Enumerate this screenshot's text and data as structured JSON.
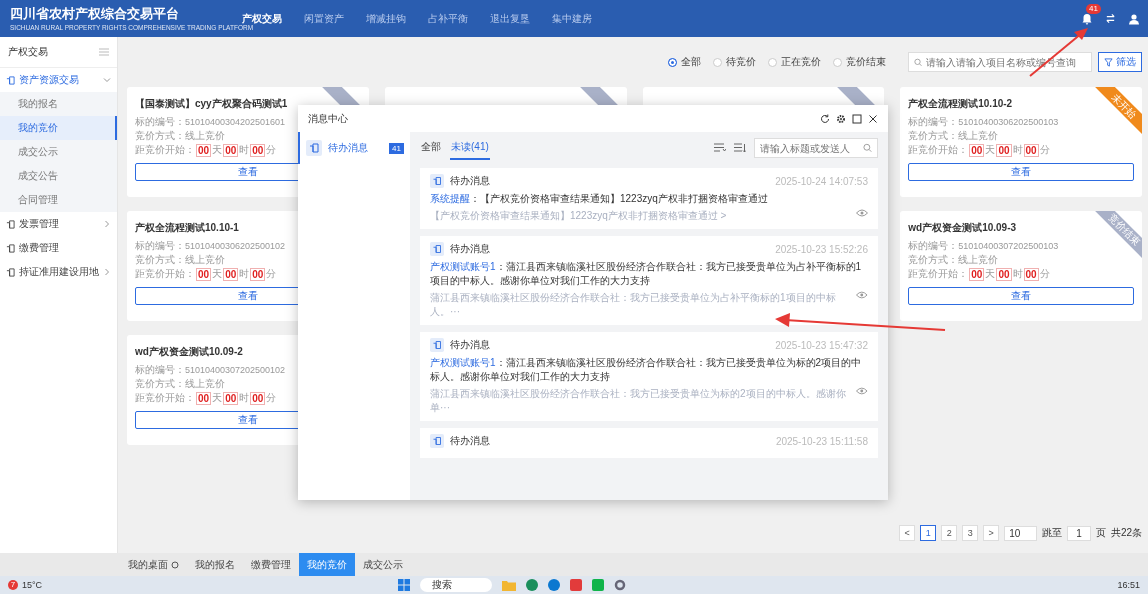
{
  "header": {
    "logo_title": "四川省农村产权综合交易平台",
    "logo_subtitle": "SICHUAN RURAL PROPERTY RIGHTS COMPREHENSIVE TRADING PLATFORM",
    "nav": [
      {
        "label": "产权交易",
        "selected": true
      },
      {
        "label": "闲置资产",
        "selected": false
      },
      {
        "label": "增减挂钩",
        "selected": false
      },
      {
        "label": "占补平衡",
        "selected": false
      },
      {
        "label": "退出复垦",
        "selected": false
      },
      {
        "label": "集中建房",
        "selected": false
      }
    ],
    "notification_count": "41"
  },
  "sidebar": {
    "title": "产权交易",
    "items": [
      {
        "label": "资产资源交易",
        "expanded": true,
        "children": [
          {
            "label": "我的报名",
            "selected": false
          },
          {
            "label": "我的竞价",
            "selected": true
          },
          {
            "label": "成交公示",
            "selected": false
          },
          {
            "label": "成交公告",
            "selected": false
          },
          {
            "label": "合同管理",
            "selected": false
          }
        ]
      },
      {
        "label": "发票管理",
        "expanded": false,
        "has_children": true
      },
      {
        "label": "缴费管理",
        "expanded": false,
        "has_children": false
      },
      {
        "label": "持证准用建设用地",
        "expanded": false,
        "has_children": true
      }
    ]
  },
  "filters": {
    "options": [
      {
        "label": "全部",
        "selected": true
      },
      {
        "label": "待竞价",
        "selected": false
      },
      {
        "label": "正在竞价",
        "selected": false
      },
      {
        "label": "竞价结束",
        "selected": false
      }
    ],
    "search_placeholder": "请输入请输入项目名称或编号查询",
    "filter_button": "筛选"
  },
  "card_columns": [
    [
      {
        "title": "【国泰测试】cyy产权聚合码测试1",
        "code_label": "标的编号：",
        "code": "51010400304202501601",
        "method_label": "竞价方式：",
        "method": "线上竞价",
        "countdown_label": "距竞价开始：",
        "countdown": [
          {
            "value": "00",
            "unit": "天"
          },
          {
            "value": "00",
            "unit": "时"
          },
          {
            "value": "00",
            "unit": "分"
          }
        ],
        "button": "查看",
        "ribbon": {
          "kind": "ended"
        }
      },
      {
        "title": "产权全流程测试10.10-1",
        "code_label": "标的编号：",
        "code": "51010400306202500102",
        "method_label": "竞价方式：",
        "method": "线上竞价",
        "countdown_label": "距竞价开始：",
        "countdown": [
          {
            "value": "00",
            "unit": "天"
          },
          {
            "value": "00",
            "unit": "时"
          },
          {
            "value": "00",
            "unit": "分"
          }
        ],
        "button": "查看"
      },
      {
        "title": "wd产权资金测试10.09-2",
        "code_label": "标的编号：",
        "code": "51010400307202500102",
        "method_label": "竞价方式：",
        "method": "线上竞价",
        "countdown_label": "距竞价开始：",
        "countdown": [
          {
            "value": "00",
            "unit": "天"
          },
          {
            "value": "00",
            "unit": "时"
          },
          {
            "value": "00",
            "unit": "分"
          }
        ],
        "button": "查看"
      }
    ],
    [
      {
        "title": "产权全流程测试10.10-2",
        "code_label": "标的编号：",
        "code": "51010400306202500103",
        "method_label": "竞价方式：",
        "method": "线上竞价",
        "countdown_label": "距竞价开始：",
        "countdown": [
          {
            "value": "00",
            "unit": "天"
          },
          {
            "value": "00",
            "unit": "时"
          },
          {
            "value": "00",
            "unit": "分"
          }
        ],
        "button": "查看",
        "ribbon": {
          "kind": "pending",
          "label": "未开始"
        }
      },
      {
        "title": "wd产权资金测试10.09-3",
        "code_label": "标的编号：",
        "code": "51010400307202500103",
        "method_label": "竞价方式：",
        "method": "线上竞价",
        "countdown_label": "距竞价开始：",
        "countdown": [
          {
            "value": "00",
            "unit": "天"
          },
          {
            "value": "00",
            "unit": "时"
          },
          {
            "value": "00",
            "unit": "分"
          }
        ],
        "button": "查看",
        "ribbon": {
          "kind": "ended",
          "label": "竞价结束"
        }
      }
    ]
  ],
  "pagination": {
    "prev": "<",
    "next": ">",
    "pages": [
      {
        "label": "1",
        "selected": true
      },
      {
        "label": "2",
        "selected": false
      },
      {
        "label": "3",
        "selected": false
      }
    ],
    "page_size": "10",
    "jump_label": "跳至",
    "jump_value": "1",
    "page_unit": "页",
    "total": "共22条"
  },
  "bottom_tabs": [
    {
      "label": "我的桌面",
      "selected": false,
      "home": true
    },
    {
      "label": "我的报名",
      "selected": false
    },
    {
      "label": "缴费管理",
      "selected": false
    },
    {
      "label": "我的竞价",
      "selected": true
    },
    {
      "label": "成交公示",
      "selected": false
    }
  ],
  "message_center": {
    "title": "消息中心",
    "nav": [
      {
        "label": "待办消息",
        "count": "41",
        "selected": true
      }
    ],
    "tabs": [
      {
        "label": "全部",
        "selected": false
      },
      {
        "label": "未读(41)",
        "selected": true
      }
    ],
    "search_placeholder": "请输入标题或发送人",
    "messages": [
      {
        "type": "待办消息",
        "time": "2025-10-24 14:07:53",
        "sender": "系统提醒",
        "body": "：【产权竞价资格审查结果通知】1223zyq产权非打捆资格审查通过",
        "preview": "【产权竞价资格审查结果通知】1223zyq产权非打捆资格审查通过 >"
      },
      {
        "type": "待办消息",
        "time": "2025-10-23 15:52:26",
        "sender": "产权测试账号1",
        "body": "：蒲江县西来镇临溪社区股份经济合作联合社：我方已接受贵单位为占补平衡标的1项目的中标人。感谢你单位对我们工作的大力支持",
        "preview": "蒲江县西来镇临溪社区股份经济合作联合社：我方已接受贵单位为占补平衡标的1项目的中标人。···"
      },
      {
        "type": "待办消息",
        "time": "2025-10-23 15:47:32",
        "sender": "产权测试账号1",
        "body": "：蒲江县西来镇临溪社区股份经济合作联合社：我方已接受贵单位为标的2项目的中标人。感谢你单位对我们工作的大力支持",
        "preview": "蒲江县西来镇临溪社区股份经济合作联合社：我方已接受贵单位为标的2项目的中标人。感谢你单···"
      },
      {
        "type": "待办消息",
        "time": "2025-10-23 15:11:58"
      }
    ]
  },
  "taskbar": {
    "weather": "15°C",
    "weather_badge": "7",
    "search": "搜索",
    "time": "16:51"
  }
}
